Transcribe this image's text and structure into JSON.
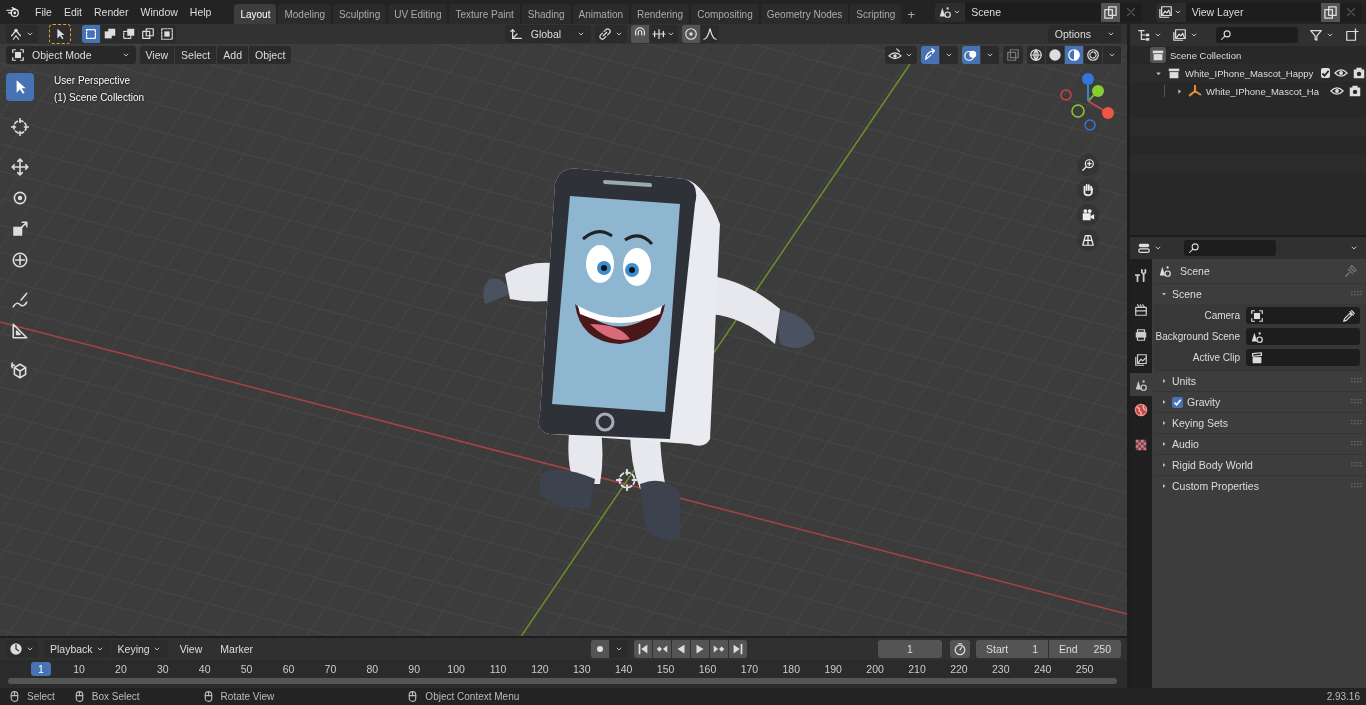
{
  "menu": [
    "File",
    "Edit",
    "Render",
    "Window",
    "Help"
  ],
  "workspaces": [
    {
      "label": "Layout",
      "selected": true
    },
    {
      "label": "Modeling",
      "selected": false
    },
    {
      "label": "Sculpting",
      "selected": false
    },
    {
      "label": "UV Editing",
      "selected": false
    },
    {
      "label": "Texture Paint",
      "selected": false
    },
    {
      "label": "Shading",
      "selected": false
    },
    {
      "label": "Animation",
      "selected": false
    },
    {
      "label": "Rendering",
      "selected": false
    },
    {
      "label": "Compositing",
      "selected": false
    },
    {
      "label": "Geometry Nodes",
      "selected": false
    },
    {
      "label": "Scripting",
      "selected": false
    }
  ],
  "add_workspace": "+",
  "scene_field": "Scene",
  "view_layer_field": "View Layer",
  "viewport": {
    "select_modes": [
      {
        "selected": true
      },
      {
        "selected": false
      },
      {
        "selected": false
      },
      {
        "selected": false
      },
      {
        "selected": false
      }
    ],
    "orientation": "Global",
    "options": "Options",
    "mode": "Object Mode",
    "menus": [
      "View",
      "Select",
      "Add",
      "Object"
    ],
    "shading": [
      {
        "kind": "wire",
        "selected": false
      },
      {
        "kind": "solid",
        "selected": false
      },
      {
        "kind": "material",
        "selected": true
      },
      {
        "kind": "rendered",
        "selected": false
      }
    ],
    "tools": [
      {
        "kind": "select",
        "selected": true
      },
      {
        "kind": "cursor",
        "selected": false
      },
      {
        "kind": "move",
        "selected": false
      },
      {
        "kind": "rotate",
        "selected": false
      },
      {
        "kind": "scale",
        "selected": false
      },
      {
        "kind": "transform",
        "selected": false
      },
      {
        "kind": "annotate",
        "selected": false
      },
      {
        "kind": "measure",
        "selected": false
      },
      {
        "kind": "addcube",
        "selected": false
      }
    ],
    "overlay_text": [
      "User Perspective",
      "(1) Scene Collection"
    ]
  },
  "outliner": {
    "root": "Scene Collection",
    "items": [
      {
        "label": "White_IPhone_Mascot_Happy",
        "expanded": true,
        "checked": true,
        "children": [
          {
            "label": "White_IPhone_Mascot_Ha",
            "expanded": false
          }
        ]
      }
    ]
  },
  "properties": {
    "tabs": [
      {
        "kind": "tool",
        "selected": false
      },
      {
        "kind": "render",
        "selected": false
      },
      {
        "kind": "output",
        "selected": false
      },
      {
        "kind": "viewlayer",
        "selected": false
      },
      {
        "kind": "scene",
        "selected": true
      },
      {
        "kind": "world",
        "selected": false
      },
      {
        "kind": "texture",
        "selected": false
      }
    ],
    "title": "Scene",
    "panels": [
      {
        "label": "Scene",
        "kind": "plain",
        "expanded": true,
        "fields": [
          {
            "label": "Camera",
            "kind": "camera"
          },
          {
            "label": "Background Scene",
            "kind": "scene"
          },
          {
            "label": "Active Clip",
            "kind": "clip"
          }
        ]
      },
      {
        "label": "Units",
        "kind": "plain",
        "expanded": false
      },
      {
        "label": "Gravity",
        "kind": "checkbox",
        "checked": true,
        "expanded": false
      },
      {
        "label": "Keying Sets",
        "kind": "plain",
        "expanded": false
      },
      {
        "label": "Audio",
        "kind": "plain",
        "expanded": false
      },
      {
        "label": "Rigid Body World",
        "kind": "plain",
        "expanded": false
      },
      {
        "label": "Custom Properties",
        "kind": "plain",
        "expanded": false
      }
    ]
  },
  "timeline": {
    "menus": [
      "Playback",
      "Keying"
    ],
    "plain_menus": [
      "View",
      "Marker"
    ],
    "current_frame": "1",
    "start_label": "Start",
    "start": "1",
    "end_label": "End",
    "end": "250",
    "playhead": "1",
    "ticks": [
      "10",
      "20",
      "30",
      "40",
      "50",
      "60",
      "70",
      "80",
      "90",
      "100",
      "110",
      "120",
      "130",
      "140",
      "150",
      "160",
      "170",
      "180",
      "190",
      "200",
      "210",
      "220",
      "230",
      "240",
      "250"
    ]
  },
  "status_bar": {
    "items": [
      "Select",
      "Box Select",
      "Rotate View",
      "Object Context Menu"
    ],
    "version": "2.93.16"
  }
}
